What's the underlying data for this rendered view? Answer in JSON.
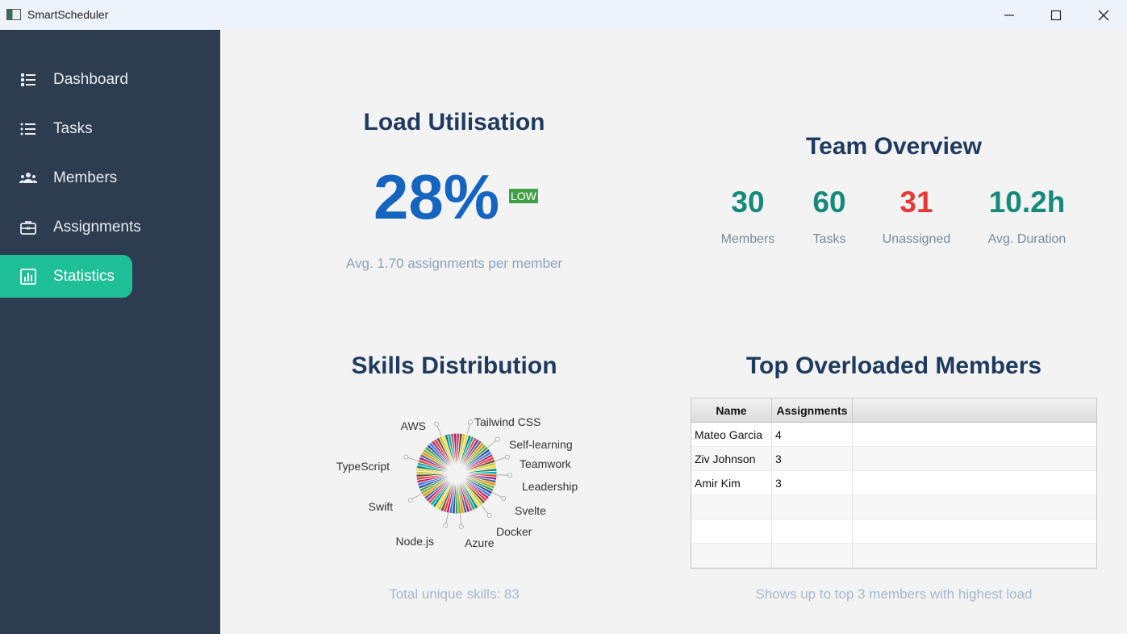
{
  "window": {
    "title": "SmartScheduler"
  },
  "sidebar": {
    "items": [
      {
        "label": "Dashboard",
        "icon": "list-bullet-icon"
      },
      {
        "label": "Tasks",
        "icon": "list-icon"
      },
      {
        "label": "Members",
        "icon": "people-icon"
      },
      {
        "label": "Assignments",
        "icon": "briefcase-icon"
      },
      {
        "label": "Statistics",
        "icon": "chart-icon",
        "active": true
      }
    ]
  },
  "load": {
    "title": "Load Utilisation",
    "percent": "28%",
    "badge": "LOW",
    "subtitle": "Avg. 1.70 assignments per member"
  },
  "team": {
    "title": "Team Overview",
    "stats": [
      {
        "value": "30",
        "label": "Members",
        "color": "#16897a"
      },
      {
        "value": "60",
        "label": "Tasks",
        "color": "#16897a"
      },
      {
        "value": "31",
        "label": "Unassigned",
        "color": "#e53935"
      },
      {
        "value": "10.2h",
        "label": "Avg. Duration",
        "color": "#16897a"
      }
    ]
  },
  "skills": {
    "title": "Skills Distribution",
    "footer": "Total unique skills: 83",
    "labels": [
      "AWS",
      "Tailwind CSS",
      "Self-learning",
      "Teamwork",
      "TypeScript",
      "Leadership",
      "Swift",
      "Svelte",
      "Docker",
      "Node.js",
      "Azure"
    ]
  },
  "overloaded": {
    "title": "Top Overloaded Members",
    "columns": [
      "Name",
      "Assignments"
    ],
    "rows": [
      [
        "Mateo Garcia",
        "4"
      ],
      [
        "Ziv Johnson",
        "3"
      ],
      [
        "Amir Kim",
        "3"
      ]
    ],
    "footer": "Shows up to top 3 members with highest load"
  }
}
